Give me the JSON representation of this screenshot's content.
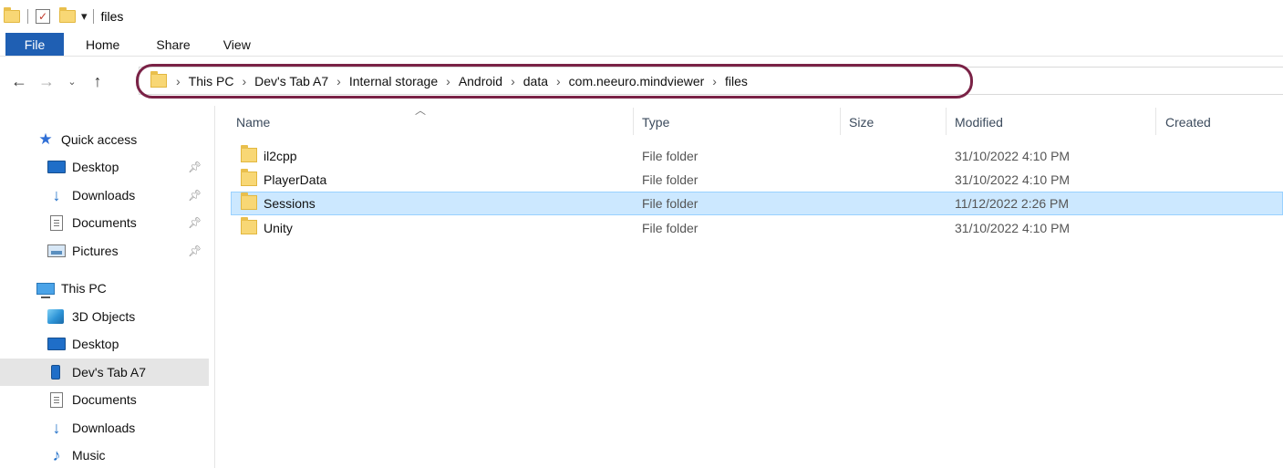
{
  "window": {
    "title": "files"
  },
  "ribbon": {
    "tabs": [
      "File",
      "Home",
      "Share",
      "View"
    ]
  },
  "nav": {
    "back": "←",
    "forward": "→",
    "recent": "⌄",
    "up": "↑"
  },
  "breadcrumb": [
    "This PC",
    "Dev's Tab A7",
    "Internal storage",
    "Android",
    "data",
    "com.neeuro.mindviewer",
    "files"
  ],
  "sidebar": {
    "quick_access": {
      "label": "Quick access",
      "items": [
        {
          "label": "Desktop",
          "icon": "desktop-icon",
          "pinned": true
        },
        {
          "label": "Downloads",
          "icon": "downloads-icon",
          "pinned": true
        },
        {
          "label": "Documents",
          "icon": "documents-icon",
          "pinned": true
        },
        {
          "label": "Pictures",
          "icon": "pictures-icon",
          "pinned": true
        }
      ]
    },
    "this_pc": {
      "label": "This PC",
      "items": [
        {
          "label": "3D Objects",
          "icon": "3d-objects-icon"
        },
        {
          "label": "Desktop",
          "icon": "desktop-icon"
        },
        {
          "label": "Dev's Tab A7",
          "icon": "phone-icon",
          "selected": true
        },
        {
          "label": "Documents",
          "icon": "documents-icon"
        },
        {
          "label": "Downloads",
          "icon": "downloads-icon"
        },
        {
          "label": "Music",
          "icon": "music-icon"
        }
      ]
    }
  },
  "columns": [
    "Name",
    "Type",
    "Size",
    "Modified",
    "Created"
  ],
  "files": [
    {
      "name": "il2cpp",
      "type": "File folder",
      "size": "",
      "modified": "31/10/2022 4:10 PM",
      "created": ""
    },
    {
      "name": "PlayerData",
      "type": "File folder",
      "size": "",
      "modified": "31/10/2022 4:10 PM",
      "created": ""
    },
    {
      "name": "Sessions",
      "type": "File folder",
      "size": "",
      "modified": "11/12/2022 2:26 PM",
      "created": "",
      "selected": true
    },
    {
      "name": "Unity",
      "type": "File folder",
      "size": "",
      "modified": "31/10/2022 4:10 PM",
      "created": ""
    }
  ],
  "colors": {
    "file_tab": "#1f5fb3",
    "selection": "#cce8ff",
    "highlight_outline": "#7a2246"
  }
}
